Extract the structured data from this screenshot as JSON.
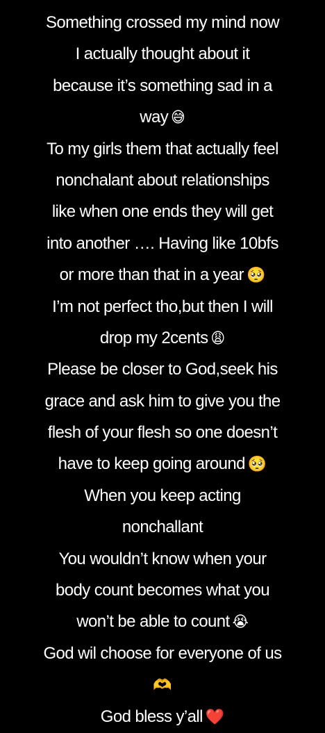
{
  "story": {
    "lines": [
      {
        "text": "Something crossed my mind now",
        "emoji": ""
      },
      {
        "text": "I actually thought about it",
        "emoji": ""
      },
      {
        "text": "because it’s something sad in a",
        "emoji": ""
      },
      {
        "text": "way",
        "emoji": "😅"
      },
      {
        "text": "To my girls them that actually feel",
        "emoji": ""
      },
      {
        "text": "nonchalant about relationships",
        "emoji": ""
      },
      {
        "text": "like when one ends they will get",
        "emoji": ""
      },
      {
        "text": "into another …. Having like 10bfs",
        "emoji": ""
      },
      {
        "text": "or more than that in a year",
        "emoji": "🥺"
      },
      {
        "text": "I’m not perfect tho,but then I will",
        "emoji": ""
      },
      {
        "text": "drop my 2cents",
        "emoji": "😩"
      },
      {
        "text": "Please be closer to God,seek his",
        "emoji": ""
      },
      {
        "text": "grace and ask him to give you the",
        "emoji": ""
      },
      {
        "text": "flesh of your flesh so one doesn’t",
        "emoji": ""
      },
      {
        "text": "have to keep going around",
        "emoji": "🥺"
      },
      {
        "text": "When you keep acting",
        "emoji": ""
      },
      {
        "text": "nonchallant",
        "emoji": ""
      },
      {
        "text": "You wouldn’t know when your",
        "emoji": ""
      },
      {
        "text": "body count becomes what you",
        "emoji": ""
      },
      {
        "text": "won’t be able to count",
        "emoji": "😭"
      },
      {
        "text": "God wil choose for everyone of us",
        "emoji": ""
      },
      {
        "text": "",
        "emoji": "🫶"
      },
      {
        "text": "God bless y’all",
        "emoji": "❤️"
      }
    ]
  }
}
